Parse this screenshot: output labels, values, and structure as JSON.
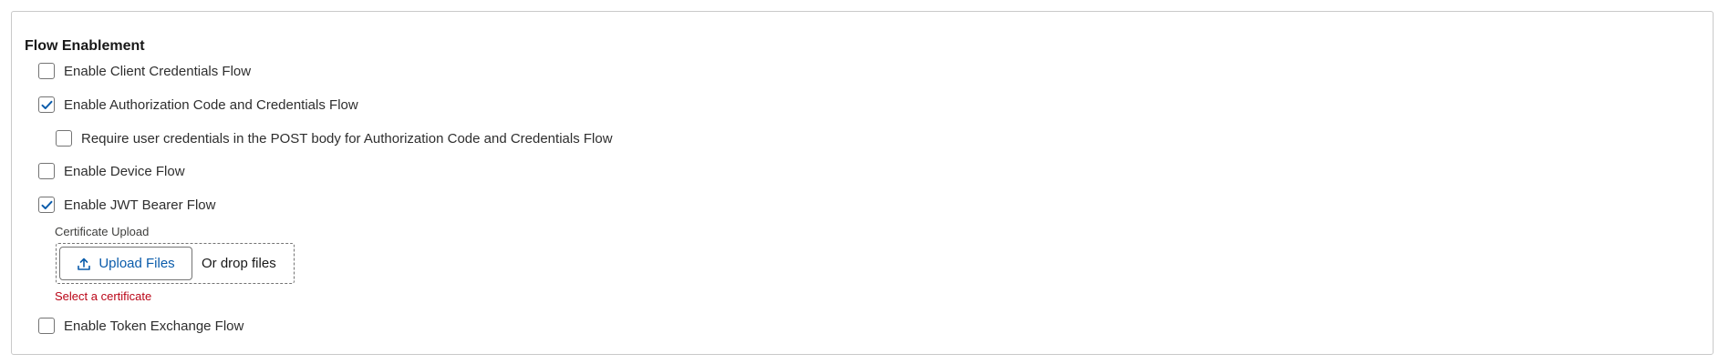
{
  "section": {
    "title": "Flow Enablement"
  },
  "options": {
    "client_credentials": {
      "label": "Enable Client Credentials Flow",
      "checked": false
    },
    "auth_code_credentials": {
      "label": "Enable Authorization Code and Credentials Flow",
      "checked": true
    },
    "require_post_body": {
      "label": "Require user credentials in the POST body for Authorization Code and Credentials Flow",
      "checked": false
    },
    "device_flow": {
      "label": "Enable Device Flow",
      "checked": false
    },
    "jwt_bearer": {
      "label": "Enable JWT Bearer Flow",
      "checked": true
    },
    "token_exchange": {
      "label": "Enable Token Exchange Flow",
      "checked": false
    }
  },
  "certificate_upload": {
    "caption": "Certificate Upload",
    "button_label": "Upload Files",
    "button_icon": "upload-icon",
    "drop_label": "Or drop files",
    "error": "Select a certificate"
  },
  "colors": {
    "accent": "#0b5cab",
    "error": "#ba0517",
    "border": "#747474"
  }
}
